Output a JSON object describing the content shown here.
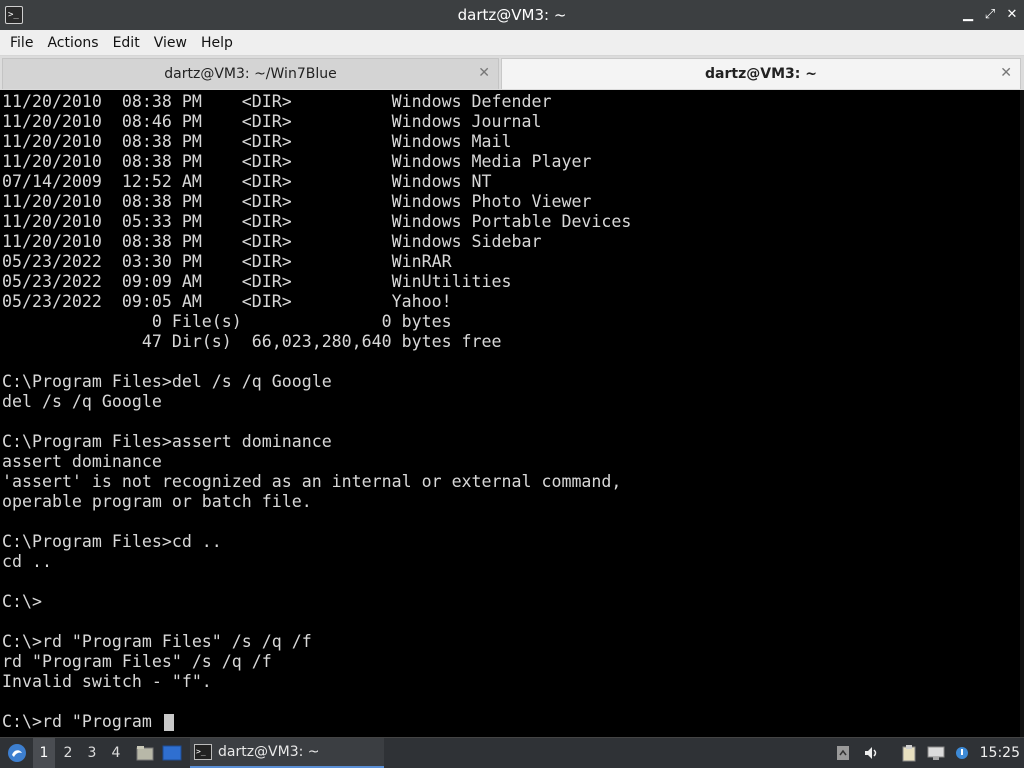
{
  "window": {
    "title": "dartz@VM3: ~",
    "app_icon": "terminal-icon",
    "app_icon_glyph": ">_",
    "controls": {
      "minimize": "▁",
      "maximize": "⤢",
      "close": "✕"
    }
  },
  "menubar": {
    "items": [
      "File",
      "Actions",
      "Edit",
      "View",
      "Help"
    ]
  },
  "tabs": [
    {
      "label": "dartz@VM3: ~/Win7Blue",
      "active": false,
      "close": "✕"
    },
    {
      "label": "dartz@VM3: ~",
      "active": true,
      "close": "✕"
    }
  ],
  "terminal": {
    "lines": [
      "11/20/2010  08:38 PM    <DIR>          Windows Defender",
      "11/20/2010  08:46 PM    <DIR>          Windows Journal",
      "11/20/2010  08:38 PM    <DIR>          Windows Mail",
      "11/20/2010  08:38 PM    <DIR>          Windows Media Player",
      "07/14/2009  12:52 AM    <DIR>          Windows NT",
      "11/20/2010  08:38 PM    <DIR>          Windows Photo Viewer",
      "11/20/2010  05:33 PM    <DIR>          Windows Portable Devices",
      "11/20/2010  08:38 PM    <DIR>          Windows Sidebar",
      "05/23/2022  03:30 PM    <DIR>          WinRAR",
      "05/23/2022  09:09 AM    <DIR>          WinUtilities",
      "05/23/2022  09:05 AM    <DIR>          Yahoo!",
      "               0 File(s)              0 bytes",
      "              47 Dir(s)  66,023,280,640 bytes free",
      "",
      "C:\\Program Files>del /s /q Google",
      "del /s /q Google",
      "",
      "C:\\Program Files>assert dominance",
      "assert dominance",
      "'assert' is not recognized as an internal or external command,",
      "operable program or batch file.",
      "",
      "C:\\Program Files>cd ..",
      "cd ..",
      "",
      "C:\\>",
      "",
      "C:\\>rd \"Program Files\" /s /q /f",
      "rd \"Program Files\" /s /q /f",
      "Invalid switch - \"f\".",
      ""
    ],
    "prompt": "C:\\>rd \"Program "
  },
  "taskbar": {
    "start_icon": "start-menu-icon",
    "workspaces": [
      "1",
      "2",
      "3",
      "4"
    ],
    "active_workspace": "1",
    "task_label": "dartz@VM3: ~",
    "clock": "15:25",
    "tray_icons": [
      "volume-icon",
      "clipboard-icon",
      "network-icon",
      "updates-icon"
    ]
  },
  "colors": {
    "terminal_bg": "#000000",
    "terminal_fg": "#d8d8d8",
    "titlebar_bg": "#3c3f41",
    "taskbar_bg": "#2f3236",
    "accent": "#5a8fd6"
  }
}
